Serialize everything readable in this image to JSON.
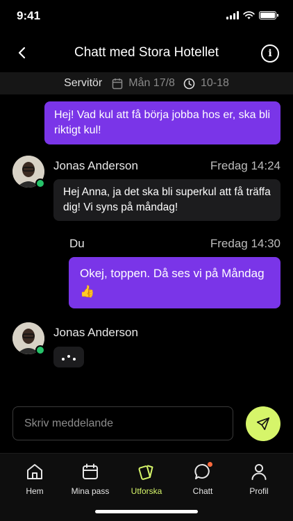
{
  "status_bar": {
    "time": "9:41"
  },
  "header": {
    "title": "Chatt med Stora Hotellet",
    "back_icon": "chevron-left-icon",
    "info_icon": "info-icon"
  },
  "shift": {
    "role": "Servitör",
    "date": "Mån 17/8",
    "hours": "10-18"
  },
  "messages": [
    {
      "type": "outgoing",
      "text": "Hej! Vad kul att få börja jobba hos er, ska bli riktigt kul!"
    },
    {
      "type": "incoming",
      "sender": "Jonas Anderson",
      "time": "Fredag 14:24",
      "text": "Hej Anna, ja det ska bli superkul att få träffa dig! Vi syns på måndag!"
    },
    {
      "type": "outgoing",
      "sender": "Du",
      "time": "Fredag 14:30",
      "text": "Okej, toppen. Då ses vi på Måndag 👍"
    },
    {
      "type": "typing",
      "sender": "Jonas Anderson"
    }
  ],
  "composer": {
    "placeholder": "Skriv meddelande"
  },
  "tabs": [
    {
      "label": "Hem",
      "icon": "home-icon",
      "active": false
    },
    {
      "label": "Mina pass",
      "icon": "calendar-icon",
      "active": false
    },
    {
      "label": "Utforska",
      "icon": "cards-icon",
      "active": true
    },
    {
      "label": "Chatt",
      "icon": "chat-bubble-icon",
      "active": false,
      "badge": true
    },
    {
      "label": "Profil",
      "icon": "user-icon",
      "active": false
    }
  ],
  "colors": {
    "accent_purple": "#7a35e8",
    "accent_lime": "#d6f56a",
    "online_green": "#27c26a",
    "notification_orange": "#ff6a3d"
  }
}
